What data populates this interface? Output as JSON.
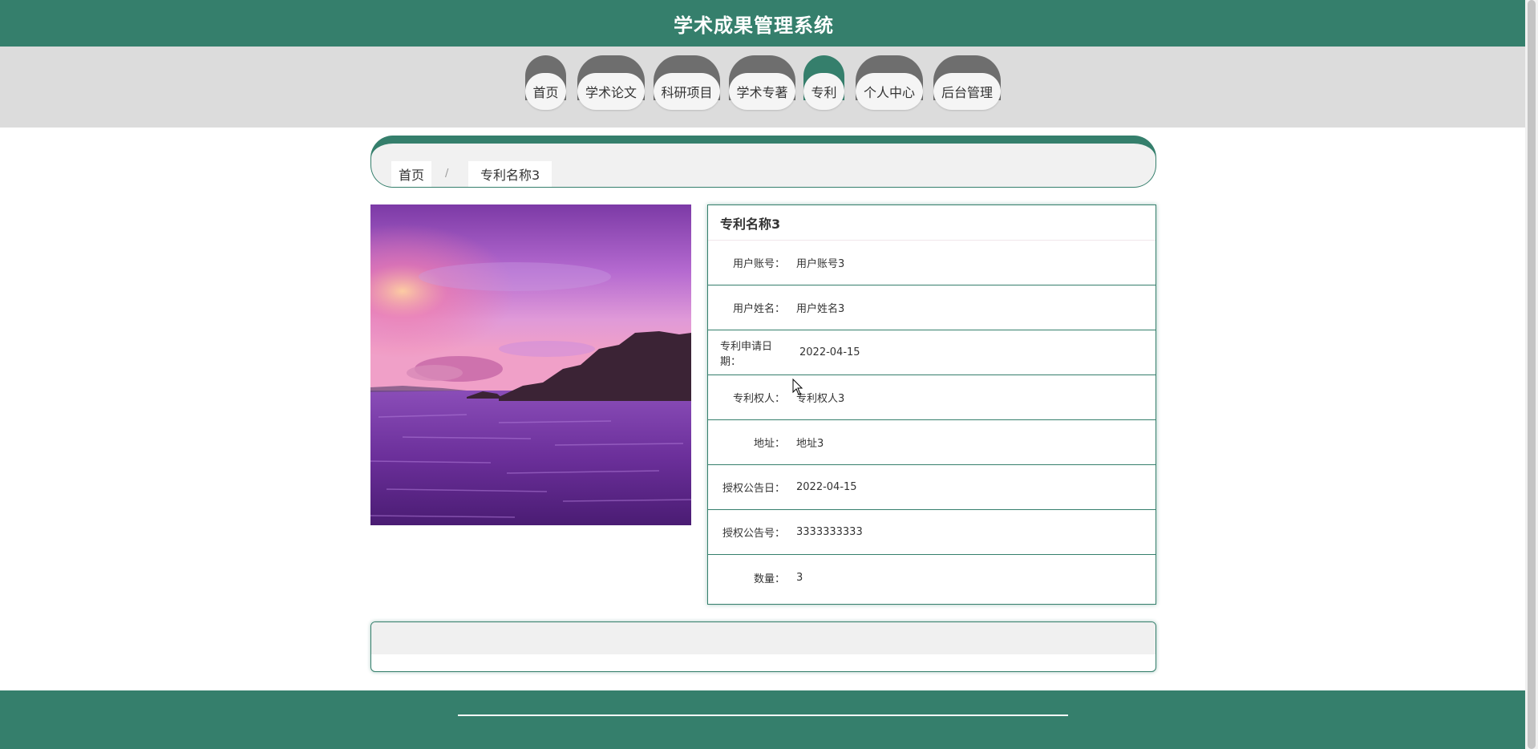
{
  "app": {
    "title": "学术成果管理系统"
  },
  "nav": {
    "items": [
      {
        "label": "首页",
        "active": false
      },
      {
        "label": "学术论文",
        "active": false
      },
      {
        "label": "科研项目",
        "active": false
      },
      {
        "label": "学术专著",
        "active": false
      },
      {
        "label": "专利",
        "active": true
      },
      {
        "label": "个人中心",
        "active": false
      },
      {
        "label": "后台管理",
        "active": false
      }
    ]
  },
  "breadcrumb": {
    "home": "首页",
    "separator": "/",
    "current": "专利名称3"
  },
  "detail": {
    "title": "专利名称3",
    "fields": [
      {
        "label": "用户账号：",
        "value": "用户账号3"
      },
      {
        "label": "用户姓名：",
        "value": "用户姓名3"
      },
      {
        "label": "专利申请日期：",
        "value": "2022-04-15"
      },
      {
        "label": "专利权人：",
        "value": "专利权人3"
      },
      {
        "label": "地址：",
        "value": "地址3"
      },
      {
        "label": "授权公告日：",
        "value": "2022-04-15"
      },
      {
        "label": "授权公告号：",
        "value": "3333333333"
      },
      {
        "label": "数量：",
        "value": "3"
      }
    ]
  },
  "colors": {
    "primary": "#357f6c",
    "nav_band": "#dcdcdc",
    "nav_cap": "#6e6e6e"
  }
}
